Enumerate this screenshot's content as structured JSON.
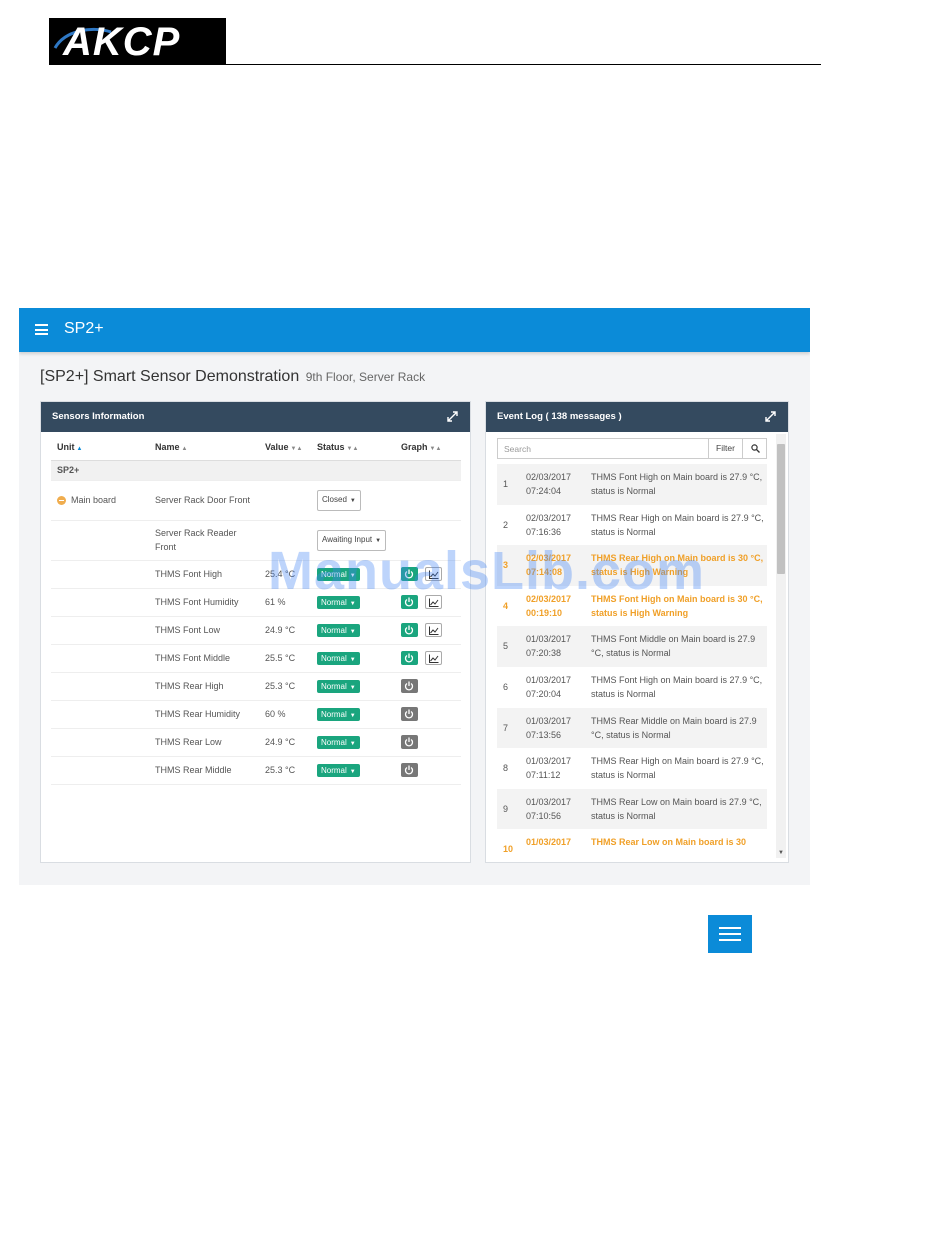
{
  "document": {
    "logo_text": "AKCP"
  },
  "app": {
    "title": "SP2+",
    "page_title": "[SP2+] Smart Sensor Demonstration",
    "page_subtitle": "9th Floor, Server Rack"
  },
  "sensors_panel": {
    "title": "Sensors Information",
    "columns": [
      "Unit",
      "Name",
      "Value",
      "Status",
      "Graph"
    ],
    "group_label": "SP2+",
    "unit_label": "Main board",
    "rows": [
      {
        "name": "Server Rack Door Front",
        "value": "",
        "status": "Closed"
      },
      {
        "name": "Server Rack Reader Front",
        "value": "",
        "status": "Awaiting Input"
      },
      {
        "name": "THMS Font High",
        "value": "25.4 °C",
        "status": "Normal"
      },
      {
        "name": "THMS Font Humidity",
        "value": "61 %",
        "status": "Normal"
      },
      {
        "name": "THMS Font Low",
        "value": "24.9 °C",
        "status": "Normal"
      },
      {
        "name": "THMS Font Middle",
        "value": "25.5 °C",
        "status": "Normal"
      },
      {
        "name": "THMS Rear High",
        "value": "25.3 °C",
        "status": "Normal"
      },
      {
        "name": "THMS Rear Humidity",
        "value": "60 %",
        "status": "Normal"
      },
      {
        "name": "THMS Rear Low",
        "value": "24.9 °C",
        "status": "Normal"
      },
      {
        "name": "THMS Rear Middle",
        "value": "25.3 °C",
        "status": "Normal"
      }
    ]
  },
  "event_panel": {
    "title": "Event Log ( 138 messages )",
    "search_placeholder": "Search",
    "filter_label": "Filter",
    "events": [
      {
        "num": "1",
        "date": "02/03/2017",
        "time": "07:24:04",
        "message": "THMS Font High on Main board is 27.9 °C, status is Normal"
      },
      {
        "num": "2",
        "date": "02/03/2017",
        "time": "07:16:36",
        "message": "THMS Rear High on Main board is 27.9 °C, status is Normal"
      },
      {
        "num": "3",
        "date": "02/03/2017",
        "time": "07:14:08",
        "message": "THMS Rear High on Main board is 30 °C, status is High Warning"
      },
      {
        "num": "4",
        "date": "02/03/2017",
        "time": "00:19:10",
        "message": "THMS Font High on Main board is 30 °C, status is High Warning"
      },
      {
        "num": "5",
        "date": "01/03/2017",
        "time": "07:20:38",
        "message": "THMS Font Middle on Main board is 27.9 °C, status is Normal"
      },
      {
        "num": "6",
        "date": "01/03/2017",
        "time": "07:20:04",
        "message": "THMS Font High on Main board is 27.9 °C, status is Normal"
      },
      {
        "num": "7",
        "date": "01/03/2017",
        "time": "07:13:56",
        "message": "THMS Rear Middle on Main board is 27.9 °C, status is Normal"
      },
      {
        "num": "8",
        "date": "01/03/2017",
        "time": "07:11:12",
        "message": "THMS Rear High on Main board is 27.9 °C, status is Normal"
      },
      {
        "num": "9",
        "date": "01/03/2017",
        "time": "07:10:56",
        "message": "THMS Rear Low on Main board is 27.9 °C, status is Normal"
      },
      {
        "num": "10",
        "date": "01/03/2017",
        "time": "",
        "message": "THMS Rear Low on Main board is 30"
      }
    ]
  },
  "watermark": "ManualsLib.com",
  "colors": {
    "topbar": "#0b8bd8",
    "panel_header": "#344a5f",
    "status_normal": "#1aa57e",
    "warning": "#f0a028"
  }
}
